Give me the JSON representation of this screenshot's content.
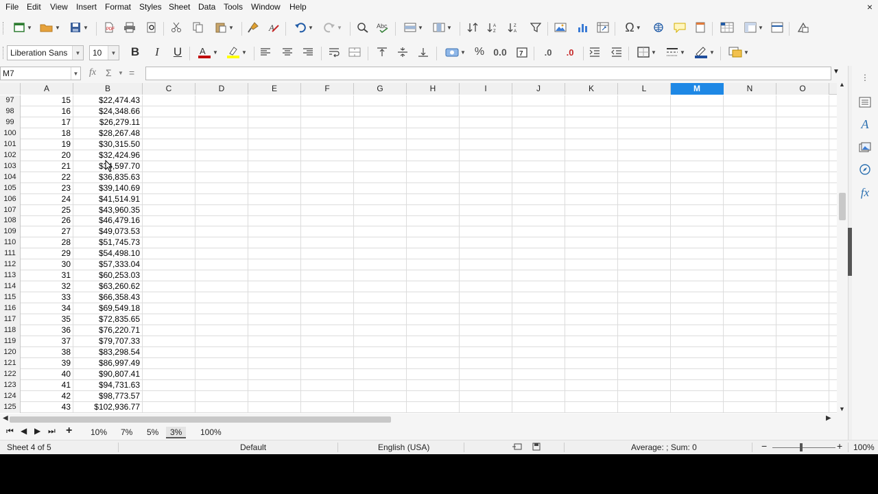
{
  "menu": [
    "File",
    "Edit",
    "View",
    "Insert",
    "Format",
    "Styles",
    "Sheet",
    "Data",
    "Tools",
    "Window",
    "Help"
  ],
  "window_close": "×",
  "font": {
    "name": "Liberation Sans",
    "size": "10"
  },
  "toolbar_glyphs": {
    "bold": "B",
    "italic": "I",
    "underline": "U",
    "percent": "%",
    "number": "0.0",
    "decimal_add": ".0",
    "decimal_del": ".0",
    "special_char": "Ω"
  },
  "formula_bar": {
    "name_box": "M7",
    "fx": "fx",
    "sum": "Σ",
    "equals": "=",
    "content": ""
  },
  "columns": [
    "A",
    "B",
    "C",
    "D",
    "E",
    "F",
    "G",
    "H",
    "I",
    "J",
    "K",
    "L",
    "M",
    "N",
    "O"
  ],
  "selected_column": "M",
  "rows": [
    {
      "row": "97",
      "a": "15",
      "b": "$22,474.43"
    },
    {
      "row": "98",
      "a": "16",
      "b": "$24,348.66"
    },
    {
      "row": "99",
      "a": "17",
      "b": "$26,279.11"
    },
    {
      "row": "100",
      "a": "18",
      "b": "$28,267.48"
    },
    {
      "row": "101",
      "a": "19",
      "b": "$30,315.50"
    },
    {
      "row": "102",
      "a": "20",
      "b": "$32,424.96"
    },
    {
      "row": "103",
      "a": "21",
      "b": "$34,597.70"
    },
    {
      "row": "104",
      "a": "22",
      "b": "$36,835.63"
    },
    {
      "row": "105",
      "a": "23",
      "b": "$39,140.69"
    },
    {
      "row": "106",
      "a": "24",
      "b": "$41,514.91"
    },
    {
      "row": "107",
      "a": "25",
      "b": "$43,960.35"
    },
    {
      "row": "108",
      "a": "26",
      "b": "$46,479.16"
    },
    {
      "row": "109",
      "a": "27",
      "b": "$49,073.53"
    },
    {
      "row": "110",
      "a": "28",
      "b": "$51,745.73"
    },
    {
      "row": "111",
      "a": "29",
      "b": "$54,498.10"
    },
    {
      "row": "112",
      "a": "30",
      "b": "$57,333.04"
    },
    {
      "row": "113",
      "a": "31",
      "b": "$60,253.03"
    },
    {
      "row": "114",
      "a": "32",
      "b": "$63,260.62"
    },
    {
      "row": "115",
      "a": "33",
      "b": "$66,358.43"
    },
    {
      "row": "116",
      "a": "34",
      "b": "$69,549.18"
    },
    {
      "row": "117",
      "a": "35",
      "b": "$72,835.65"
    },
    {
      "row": "118",
      "a": "36",
      "b": "$76,220.71"
    },
    {
      "row": "119",
      "a": "37",
      "b": "$79,707.33"
    },
    {
      "row": "120",
      "a": "38",
      "b": "$83,298.54"
    },
    {
      "row": "121",
      "a": "39",
      "b": "$86,997.49"
    },
    {
      "row": "122",
      "a": "40",
      "b": "$90,807.41"
    },
    {
      "row": "123",
      "a": "41",
      "b": "$94,731.63"
    },
    {
      "row": "124",
      "a": "42",
      "b": "$98,773.57"
    },
    {
      "row": "125",
      "a": "43",
      "b": "$102,936.77"
    }
  ],
  "sheet_tabs": [
    {
      "label": "10%",
      "active": false
    },
    {
      "label": "7%",
      "active": false
    },
    {
      "label": "5%",
      "active": false
    },
    {
      "label": "3%",
      "active": true
    },
    {
      "label": "100%",
      "active": false
    }
  ],
  "add_sheet": "+",
  "status": {
    "sheet": "Sheet 4 of 5",
    "page_style": "Default",
    "language": "English (USA)",
    "selection_summary": "Average: ; Sum: 0",
    "zoom": "100%",
    "zoom_minus": "−",
    "zoom_plus": "+"
  },
  "colors": {
    "accent": "#1e88e5",
    "font_color": "#c00000",
    "highlight": "#ffff00",
    "line_color": "#1f4e9c"
  }
}
